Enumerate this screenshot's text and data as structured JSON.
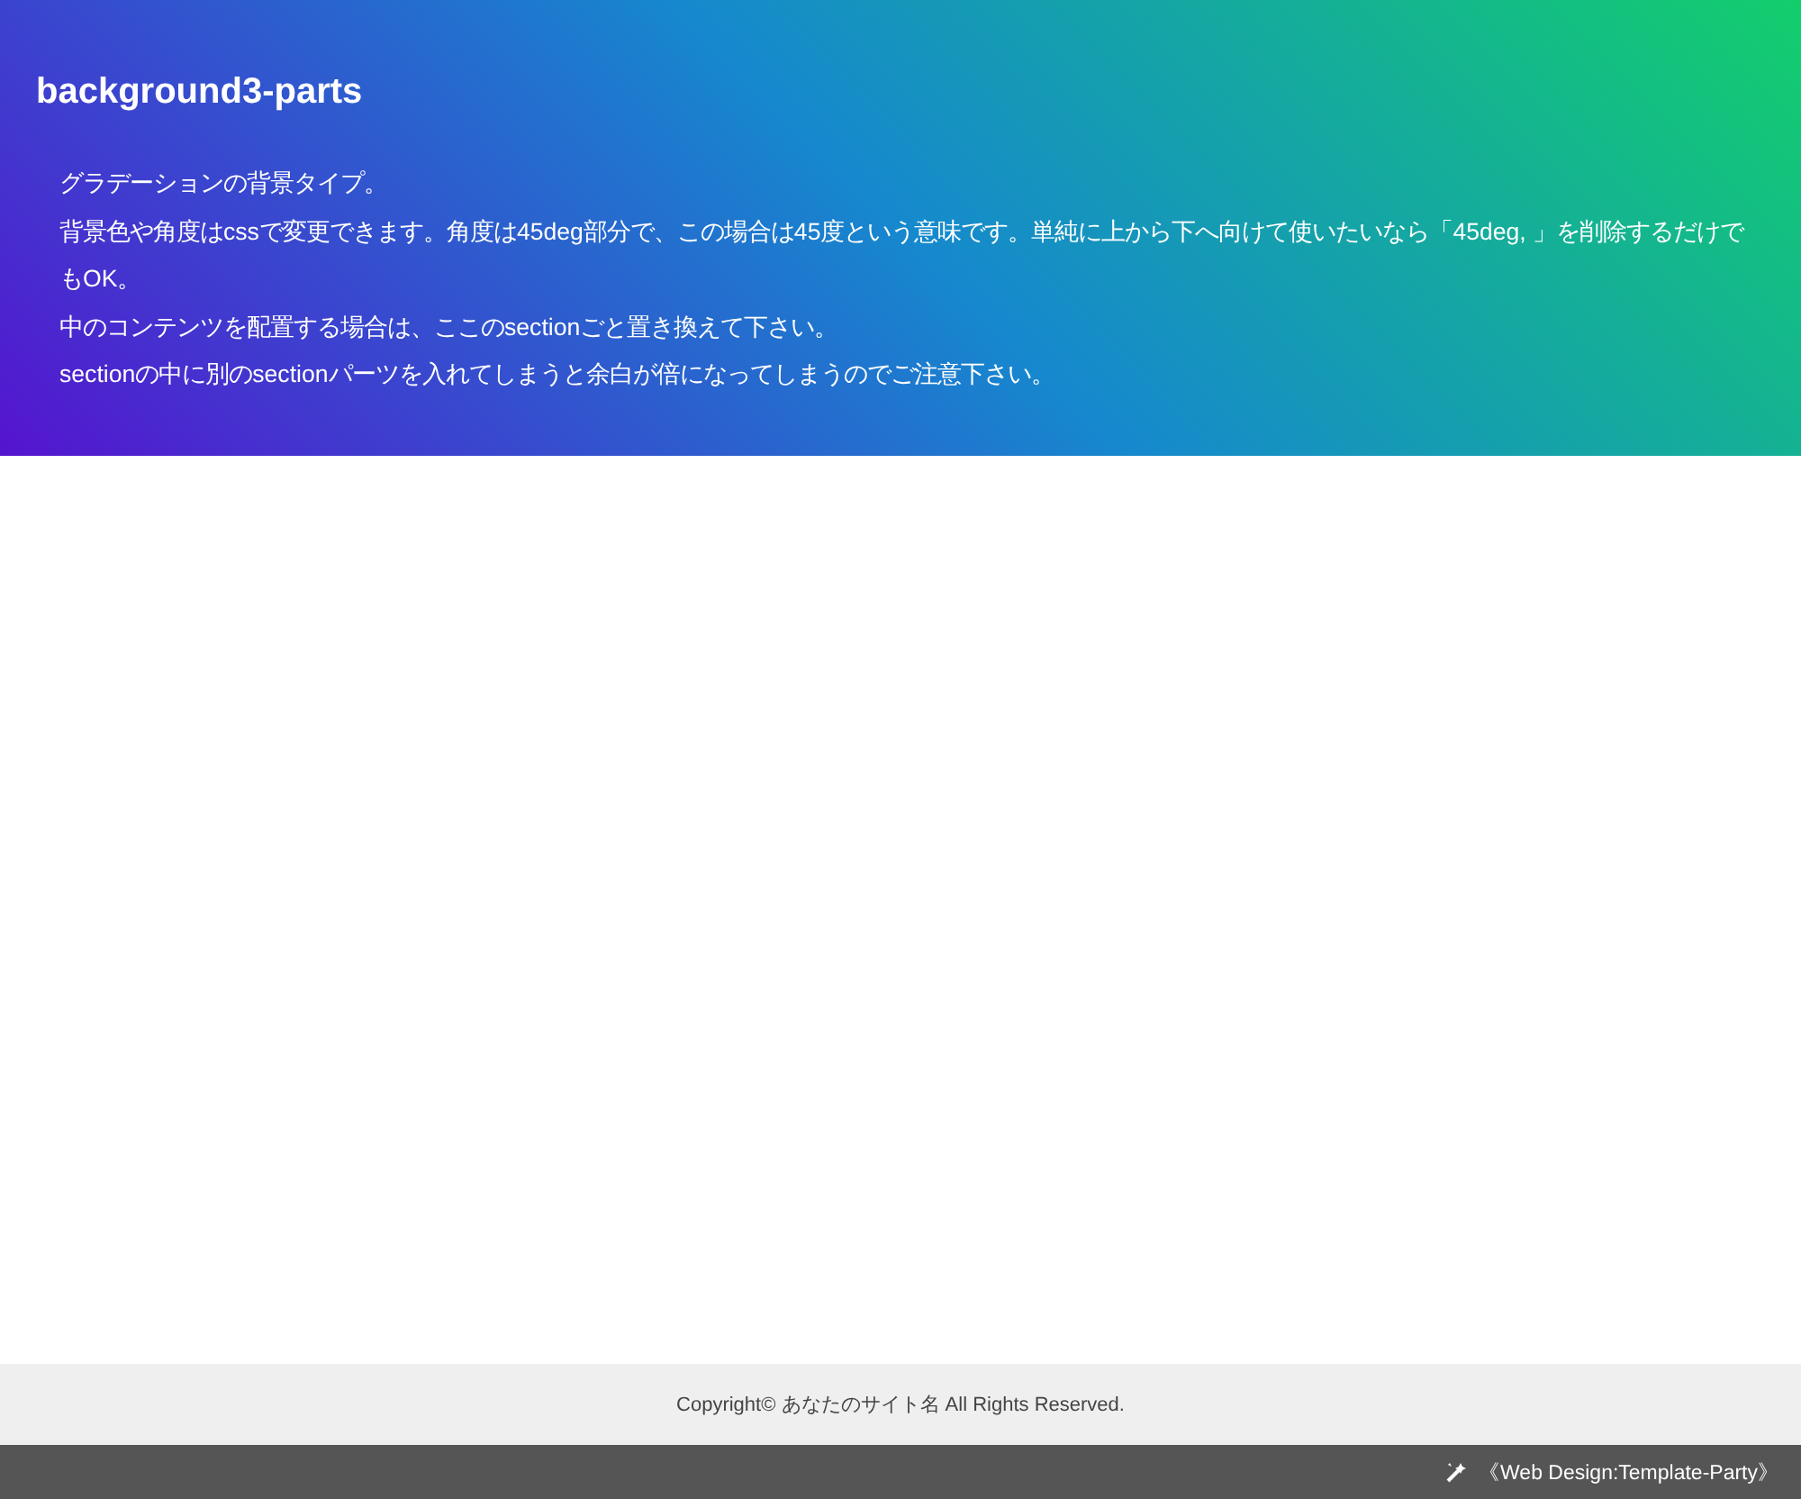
{
  "section": {
    "title": "background3-parts",
    "paragraphs": [
      "グラデーションの背景タイプ。",
      "背景色や角度はcssで変更できます。角度は45deg部分で、この場合は45度という意味です。単純に上から下へ向けて使いたいなら「45deg, 」を削除するだけでもOK。",
      "中のコンテンツを配置する場合は、ここのsectionごと置き換えて下さい。",
      "sectionの中に別のsectionパーツを入れてしまうと余白が倍になってしまうのでご注意下さい。"
    ]
  },
  "footer": {
    "copyright": "Copyright© あなたのサイト名 All Rights Reserved."
  },
  "credit_bar": {
    "link": "《Web Design:Template-Party》"
  }
}
